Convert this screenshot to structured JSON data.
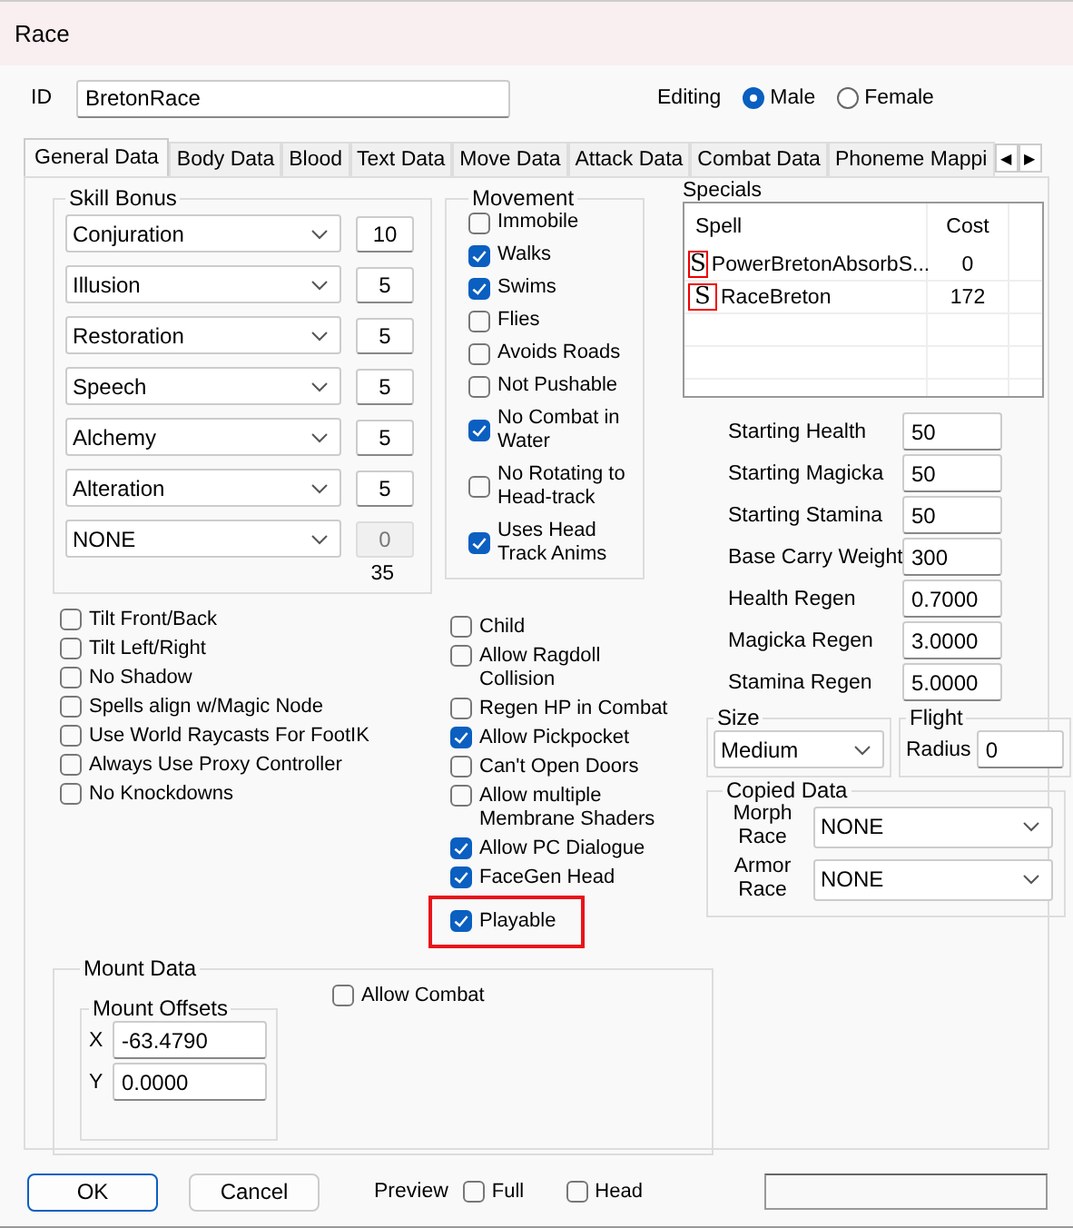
{
  "window": {
    "title": "Race"
  },
  "id_field": {
    "label": "ID",
    "value": "BretonRace"
  },
  "editing": {
    "label": "Editing",
    "options": [
      {
        "label": "Male",
        "selected": true
      },
      {
        "label": "Female",
        "selected": false
      }
    ]
  },
  "tabs": [
    {
      "label": "General Data",
      "selected": true
    },
    {
      "label": "Body Data",
      "selected": false
    },
    {
      "label": "Blood",
      "selected": false
    },
    {
      "label": "Text Data",
      "selected": false
    },
    {
      "label": "Move Data",
      "selected": false
    },
    {
      "label": "Attack Data",
      "selected": false
    },
    {
      "label": "Combat Data",
      "selected": false
    },
    {
      "label": "Phoneme Mappi",
      "selected": false
    }
  ],
  "tab_scroll": [
    "◀",
    "▶"
  ],
  "skill_bonus": {
    "title": "Skill Bonus",
    "rows": [
      {
        "skill": "Conjuration",
        "value": "10",
        "disabled": false
      },
      {
        "skill": "Illusion",
        "value": "5",
        "disabled": false
      },
      {
        "skill": "Restoration",
        "value": "5",
        "disabled": false
      },
      {
        "skill": "Speech",
        "value": "5",
        "disabled": false
      },
      {
        "skill": "Alchemy",
        "value": "5",
        "disabled": false
      },
      {
        "skill": "Alteration",
        "value": "5",
        "disabled": false
      },
      {
        "skill": "NONE",
        "value": "0",
        "disabled": true
      }
    ],
    "total": "35"
  },
  "movement": {
    "title": "Movement",
    "flags": [
      {
        "label": "Immobile",
        "checked": false
      },
      {
        "label": "Walks",
        "checked": true
      },
      {
        "label": "Swims",
        "checked": true
      },
      {
        "label": "Flies",
        "checked": false
      },
      {
        "label": "Avoids Roads",
        "checked": false
      },
      {
        "label": "Not Pushable",
        "checked": false
      },
      {
        "label": "No Combat in Water",
        "checked": true
      },
      {
        "label": "No Rotating to Head-track",
        "checked": false
      },
      {
        "label": "Uses Head Track Anims",
        "checked": true
      }
    ]
  },
  "specials": {
    "title": "Specials",
    "columns": [
      "Spell",
      "Cost"
    ],
    "rows": [
      {
        "icon": "S",
        "spell": "PowerBretonAbsorbS...",
        "cost": "0"
      },
      {
        "icon": "S",
        "spell": "RaceBreton",
        "cost": "172"
      }
    ]
  },
  "stats": [
    {
      "label": "Starting Health",
      "value": "50"
    },
    {
      "label": "Starting Magicka",
      "value": "50"
    },
    {
      "label": "Starting Stamina",
      "value": "50"
    },
    {
      "label": "Base Carry Weight",
      "value": "300"
    },
    {
      "label": "Health Regen",
      "value": "0.7000"
    },
    {
      "label": "Magicka Regen",
      "value": "3.0000"
    },
    {
      "label": "Stamina Regen",
      "value": "5.0000"
    }
  ],
  "flags_left": [
    {
      "label": "Tilt Front/Back",
      "checked": false
    },
    {
      "label": "Tilt Left/Right",
      "checked": false
    },
    {
      "label": "No Shadow",
      "checked": false
    },
    {
      "label": "Spells align w/Magic Node",
      "checked": false
    },
    {
      "label": "Use World Raycasts For FootIK",
      "checked": false
    },
    {
      "label": "Always Use Proxy Controller",
      "checked": false
    },
    {
      "label": "No Knockdowns",
      "checked": false
    }
  ],
  "flags_middle": [
    {
      "label": "Child",
      "checked": false,
      "highlighted": false
    },
    {
      "label": "Allow Ragdoll Collision",
      "checked": false,
      "highlighted": false
    },
    {
      "label": "Regen HP in Combat",
      "checked": false,
      "highlighted": false
    },
    {
      "label": "Allow Pickpocket",
      "checked": true,
      "highlighted": false
    },
    {
      "label": "Can't Open Doors",
      "checked": false,
      "highlighted": false
    },
    {
      "label": "Allow multiple Membrane Shaders",
      "checked": false,
      "highlighted": false
    },
    {
      "label": "Allow PC Dialogue",
      "checked": true,
      "highlighted": false
    },
    {
      "label": "FaceGen Head",
      "checked": true,
      "highlighted": false
    },
    {
      "label": "Playable",
      "checked": true,
      "highlighted": true
    }
  ],
  "size": {
    "title": "Size",
    "value": "Medium"
  },
  "flight": {
    "title": "Flight",
    "label": "Radius",
    "value": "0"
  },
  "copied_data": {
    "title": "Copied Data",
    "rows": [
      {
        "label": "Morph Race",
        "value": "NONE"
      },
      {
        "label": "Armor Race",
        "value": "NONE"
      }
    ]
  },
  "mount_data": {
    "title": "Mount Data",
    "allow_combat": {
      "label": "Allow Combat",
      "checked": false
    },
    "offsets": {
      "title": "Mount Offsets",
      "rows": [
        {
          "label": "X",
          "value": "-63.4790"
        },
        {
          "label": "Y",
          "value": "0.0000"
        }
      ]
    }
  },
  "footer": {
    "buttons": [
      {
        "label": "OK",
        "kind": "default"
      },
      {
        "label": "Cancel",
        "kind": "normal"
      }
    ],
    "preview": {
      "label": "Preview",
      "options": [
        {
          "label": "Full",
          "checked": false
        },
        {
          "label": "Head",
          "checked": false
        }
      ]
    }
  }
}
